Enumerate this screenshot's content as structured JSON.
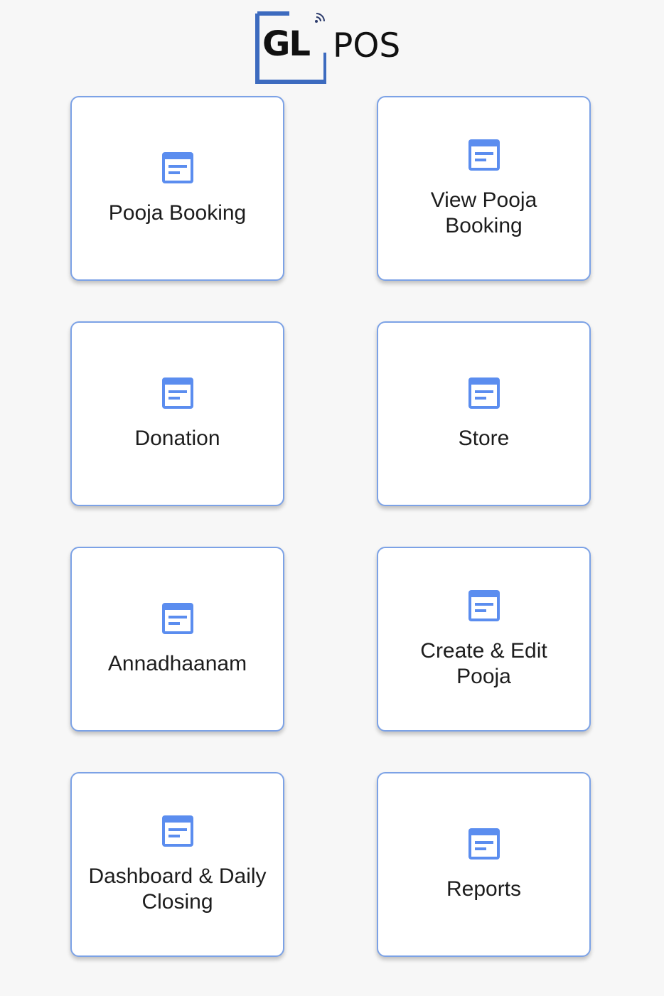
{
  "header": {
    "logo_gl": "GL",
    "logo_pos": "POS",
    "logo_color": "#3d6bbf"
  },
  "menu": {
    "icon": "document-icon",
    "accent_color": "#5b8def",
    "tiles": [
      {
        "label": "Pooja Booking"
      },
      {
        "label": "View Pooja Booking"
      },
      {
        "label": "Donation"
      },
      {
        "label": "Store"
      },
      {
        "label": "Annadhaanam"
      },
      {
        "label": "Create & Edit Pooja"
      },
      {
        "label": "Dashboard & Daily Closing"
      },
      {
        "label": "Reports"
      }
    ]
  }
}
